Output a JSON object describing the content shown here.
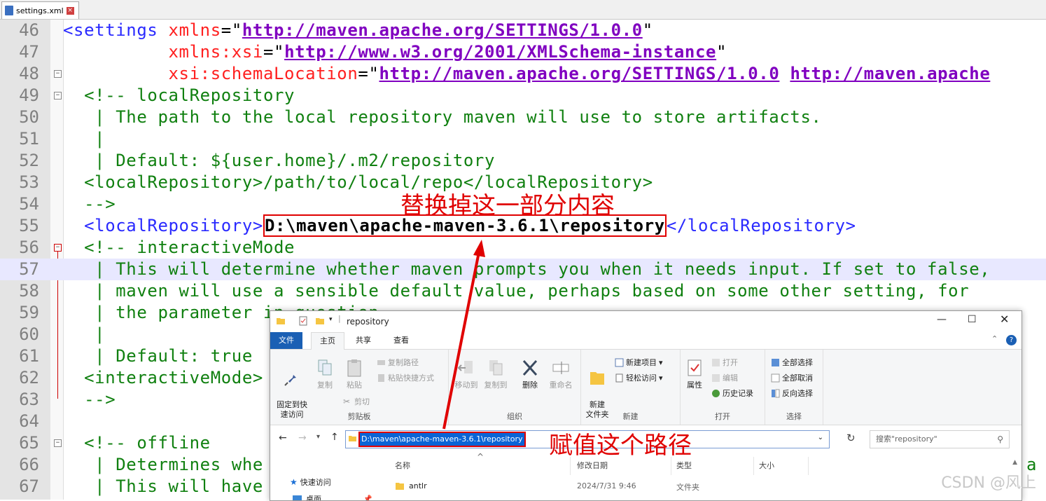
{
  "tab": {
    "name": "settings.xml"
  },
  "lines": [
    {
      "num": "46"
    },
    {
      "num": "47"
    },
    {
      "num": "48"
    },
    {
      "num": "49"
    },
    {
      "num": "50"
    },
    {
      "num": "51"
    },
    {
      "num": "52"
    },
    {
      "num": "53"
    },
    {
      "num": "54"
    },
    {
      "num": "55"
    },
    {
      "num": "56"
    },
    {
      "num": "57"
    },
    {
      "num": "58"
    },
    {
      "num": "59"
    },
    {
      "num": "60"
    },
    {
      "num": "61"
    },
    {
      "num": "62"
    },
    {
      "num": "63"
    },
    {
      "num": "64"
    },
    {
      "num": "65"
    },
    {
      "num": "66"
    },
    {
      "num": "67"
    }
  ],
  "code": {
    "l46_tag": "<settings",
    "l46_attr": "xmlns",
    "l46_eq": "=\"",
    "l46_val": "http://maven.apache.org/SETTINGS/1.0.0",
    "l46_end": "\"",
    "l47_attr": "xmlns:xsi",
    "l47_eq": "=\"",
    "l47_val": "http://www.w3.org/2001/XMLSchema-instance",
    "l47_end": "\"",
    "l48_attr": "xsi:schemaLocation",
    "l48_eq": "=\"",
    "l48_val1": "http://maven.apache.org/SETTINGS/1.0.0",
    "l48_val2": "http://maven.apache",
    "l49": "<!-- localRepository",
    "l50": "| The path to the local repository maven will use to store artifacts.",
    "l51": "|",
    "l52": "| Default: ${user.home}/.m2/repository",
    "l53": "<localRepository>/path/to/local/repo</localRepository>",
    "l54": "-->",
    "l55_open": "<localRepository>",
    "l55_val": "D:\\maven\\apache-maven-3.6.1\\repository",
    "l55_close": "</localRepository>",
    "l56": "<!-- interactiveMode",
    "l57": "| This will determine whether maven prompts you when it needs input. If set to false,",
    "l58": "| maven will use a sensible default value, perhaps based on some other setting, for",
    "l59": "| the parameter in question.",
    "l60": "|",
    "l61": "| Default: true",
    "l62": "<interactiveMode>",
    "l63": "-->",
    "l65": "<!-- offline",
    "l66": "| Determines whe",
    "l66_right": "a",
    "l67": "| This will have"
  },
  "annotations": {
    "replace": "替换掉这一部分内容",
    "assign": "赋值这个路径"
  },
  "explorer": {
    "title": "repository",
    "tabs": [
      "文件",
      "主页",
      "共享",
      "查看"
    ],
    "ribbon": {
      "pin": "固定到快\n速访问",
      "copy": "复制",
      "paste": "粘贴",
      "copy_path": "复制路径",
      "paste_shortcut": "粘贴快捷方式",
      "cut": "剪切",
      "clipboard_label": "剪贴板",
      "move_to": "移动到",
      "copy_to": "复制到",
      "delete": "删除",
      "rename": "重命名",
      "organize_label": "组织",
      "new_folder": "新建\n文件夹",
      "new_item": "新建项目",
      "easy_access": "轻松访问",
      "new_label": "新建",
      "properties": "属性",
      "open": "打开",
      "edit": "编辑",
      "history": "历史记录",
      "open_label": "打开",
      "select_all": "全部选择",
      "select_none": "全部取消",
      "invert": "反向选择",
      "select_label": "选择"
    },
    "address": "D:\\maven\\apache-maven-3.6.1\\repository",
    "search_placeholder": "搜索\"repository\"",
    "columns": [
      "名称",
      "修改日期",
      "类型",
      "大小"
    ],
    "quick_access": "快速访问",
    "desktop": "桌面",
    "files": [
      {
        "name": "antlr",
        "date": "2024/7/31 9:46",
        "type": "文件夹"
      }
    ]
  },
  "watermark": "CSDN @风上",
  "colors": {
    "annotation": "#e00000",
    "tag": "#2a2aff",
    "attr": "#ff2020",
    "value": "#8000c0",
    "comment": "#108010"
  }
}
